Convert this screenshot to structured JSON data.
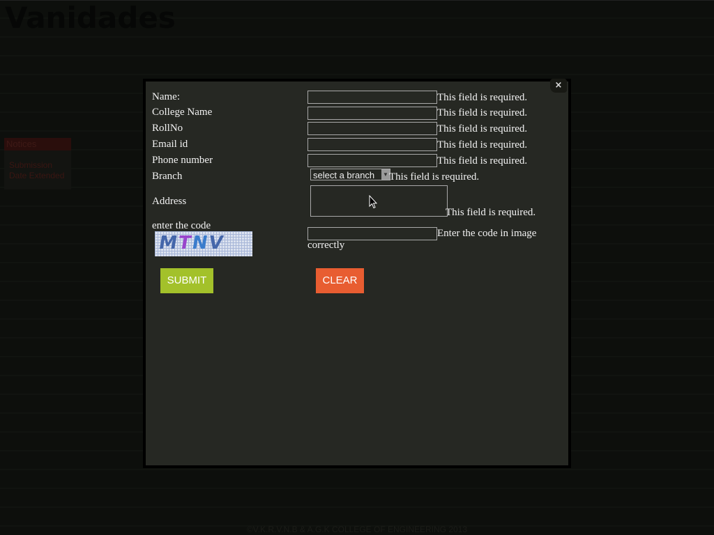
{
  "site": {
    "title": "Vanidades",
    "notices": {
      "heading": "Notices",
      "lines": [
        "Submission",
        "Date Extended"
      ]
    },
    "footer": "©V.K.R.V.N.B & A.G.K COLLEGE OF ENGINEERING 2013"
  },
  "modal": {
    "close_label": "×",
    "fields": [
      {
        "label": "Name:",
        "value": "",
        "error": "This field is required."
      },
      {
        "label": "College Name",
        "value": "",
        "error": "This field is required."
      },
      {
        "label": "RollNo",
        "value": "",
        "error": "This field is required."
      },
      {
        "label": "Email id",
        "value": "",
        "error": "This field is required."
      },
      {
        "label": "Phone number",
        "value": "",
        "error": "This field is required."
      }
    ],
    "branch": {
      "label": "Branch",
      "selected": "select a branch",
      "error": "This field is required."
    },
    "address": {
      "label": "Address",
      "value": "",
      "error": "This field is required."
    },
    "captcha": {
      "label": "enter the code",
      "image_text": [
        "M",
        "T",
        "N",
        "V"
      ],
      "value": "",
      "error": "Enter the code in image correctly"
    },
    "submit_label": "SUBMIT",
    "clear_label": "CLEAR"
  }
}
